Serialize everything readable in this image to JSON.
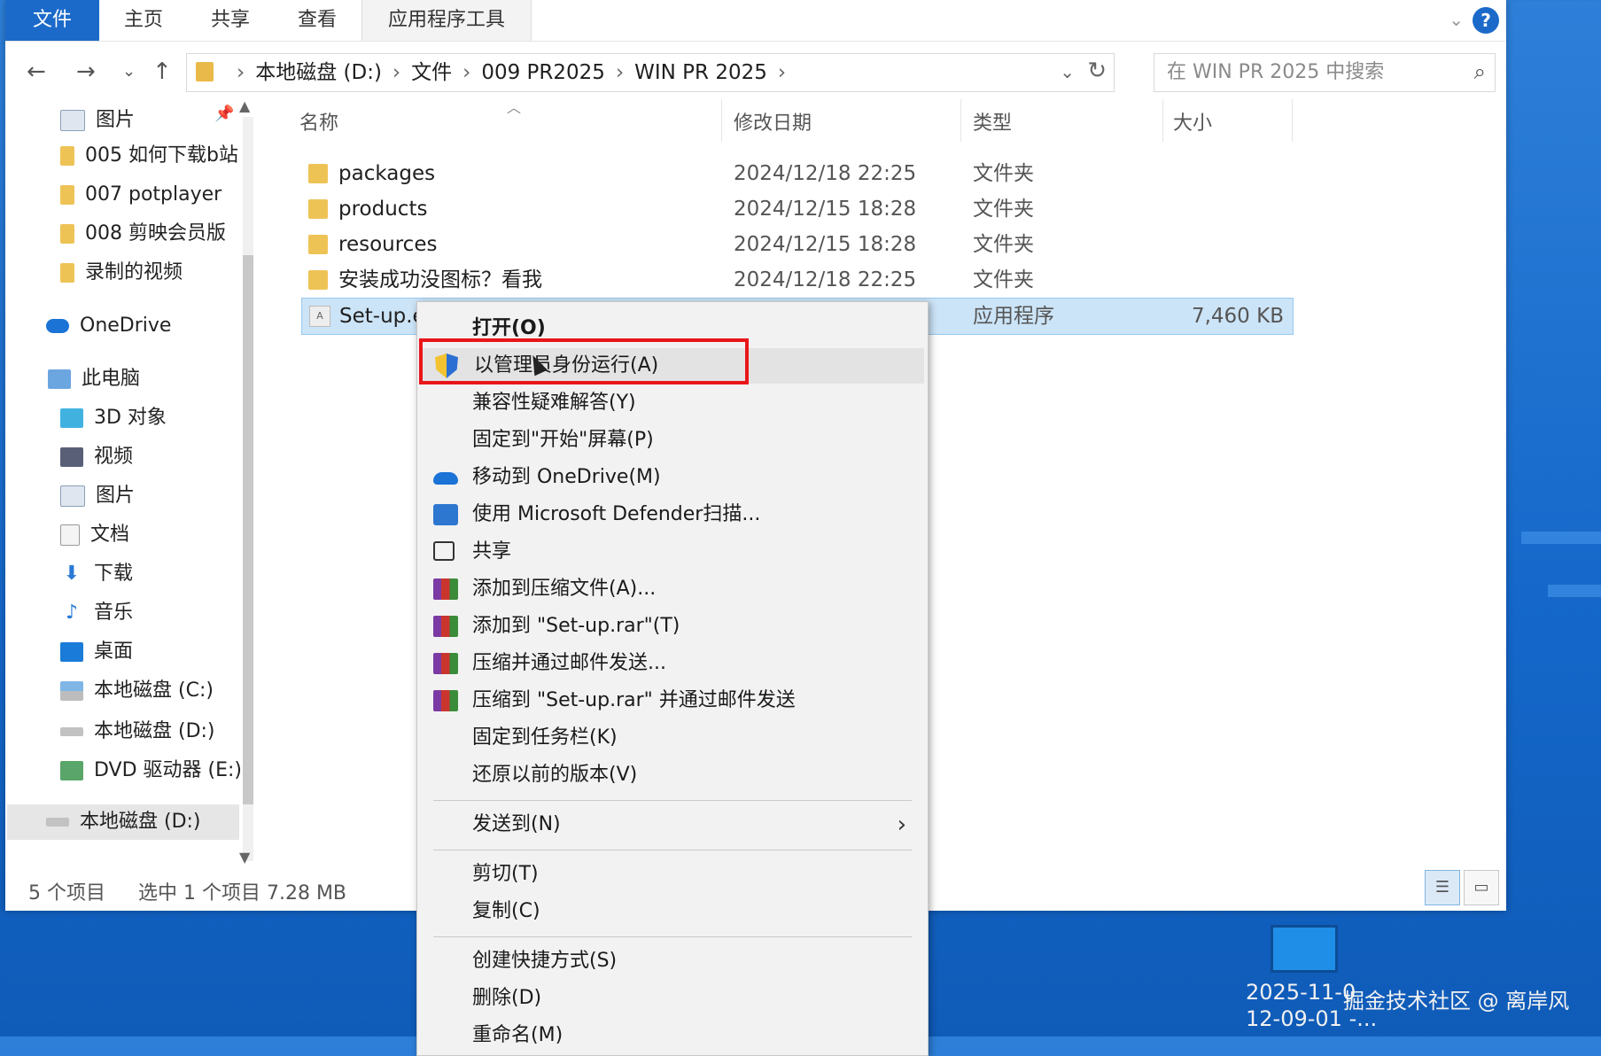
{
  "ribbon": {
    "tabs": [
      "文件",
      "主页",
      "共享",
      "查看",
      "应用程序工具"
    ],
    "help": "?"
  },
  "address": {
    "crumbs": [
      "本地磁盘 (D:)",
      "文件",
      "009 PR2025",
      "WIN PR 2025"
    ],
    "search_placeholder": "在 WIN PR 2025 中搜索"
  },
  "nav": {
    "items": [
      {
        "label": "图片",
        "icon": "pictures-icon",
        "pinned": true
      },
      {
        "label": "005 如何下载b站",
        "icon": "folder-icon"
      },
      {
        "label": "007 potplayer",
        "icon": "folder-icon"
      },
      {
        "label": "008 剪映会员版",
        "icon": "folder-icon"
      },
      {
        "label": "录制的视频",
        "icon": "folder-icon"
      },
      {
        "label": "OneDrive",
        "icon": "onedrive-icon"
      },
      {
        "label": "此电脑",
        "icon": "this-pc-icon"
      },
      {
        "label": "3D 对象",
        "icon": "3d-objects-icon"
      },
      {
        "label": "视频",
        "icon": "videos-icon"
      },
      {
        "label": "图片",
        "icon": "pictures-icon"
      },
      {
        "label": "文档",
        "icon": "documents-icon"
      },
      {
        "label": "下载",
        "icon": "downloads-icon"
      },
      {
        "label": "音乐",
        "icon": "music-icon"
      },
      {
        "label": "桌面",
        "icon": "desktop-icon"
      },
      {
        "label": "本地磁盘 (C:)",
        "icon": "drive-c-icon"
      },
      {
        "label": "本地磁盘 (D:)",
        "icon": "drive-icon"
      },
      {
        "label": "DVD 驱动器 (E:)",
        "icon": "dvd-drive-icon"
      },
      {
        "label": "本地磁盘 (D:)",
        "icon": "drive-icon",
        "selected": true
      }
    ]
  },
  "columns": [
    "名称",
    "修改日期",
    "类型",
    "大小"
  ],
  "files": [
    {
      "name": "packages",
      "date": "2024/12/18 22:25",
      "type": "文件夹",
      "size": ""
    },
    {
      "name": "products",
      "date": "2024/12/15 18:28",
      "type": "文件夹",
      "size": ""
    },
    {
      "name": "resources",
      "date": "2024/12/15 18:28",
      "type": "文件夹",
      "size": ""
    },
    {
      "name": "安装成功没图标？看我",
      "date": "2024/12/18 22:25",
      "type": "文件夹",
      "size": ""
    },
    {
      "name": "Set-up.e",
      "date": "",
      "type": "应用程序",
      "size": "7,460 KB",
      "selected": true
    }
  ],
  "status": {
    "count": "5 个项目",
    "selection": "选中 1 个项目  7.28 MB"
  },
  "context_menu": {
    "items": [
      {
        "label": "打开(O)",
        "bold": true
      },
      {
        "label": "以管理员身份运行(A)",
        "icon": "uac-shield-icon",
        "highlighted": true
      },
      {
        "label": "兼容性疑难解答(Y)"
      },
      {
        "label": "固定到\"开始\"屏幕(P)"
      },
      {
        "label": "移动到 OneDrive(M)",
        "icon": "onedrive-icon"
      },
      {
        "label": "使用 Microsoft Defender扫描...",
        "icon": "defender-icon"
      },
      {
        "label": "共享",
        "icon": "share-icon"
      },
      {
        "label": "添加到压缩文件(A)...",
        "icon": "winrar-icon"
      },
      {
        "label": "添加到 \"Set-up.rar\"(T)",
        "icon": "winrar-icon"
      },
      {
        "label": "压缩并通过邮件发送...",
        "icon": "winrar-icon"
      },
      {
        "label": "压缩到 \"Set-up.rar\" 并通过邮件发送",
        "icon": "winrar-icon"
      },
      {
        "label": "固定到任务栏(K)"
      },
      {
        "label": "还原以前的版本(V)"
      },
      {
        "label": "发送到(N)",
        "submenu": true
      },
      {
        "label": "剪切(T)"
      },
      {
        "label": "复制(C)"
      },
      {
        "label": "创建快捷方式(S)"
      },
      {
        "label": "删除(D)"
      },
      {
        "label": "重命名(M)"
      }
    ]
  },
  "desktop": {
    "file_label_1": "2025-11-0",
    "file_label_2": "12-09-01 -...",
    "watermark": "掘金技术社区 @ 离岸风"
  },
  "colors": {
    "accent": "#1b6ac9",
    "selection": "#cce4f7",
    "highlight_box": "#e8161a",
    "desktop": "#1467c9"
  }
}
